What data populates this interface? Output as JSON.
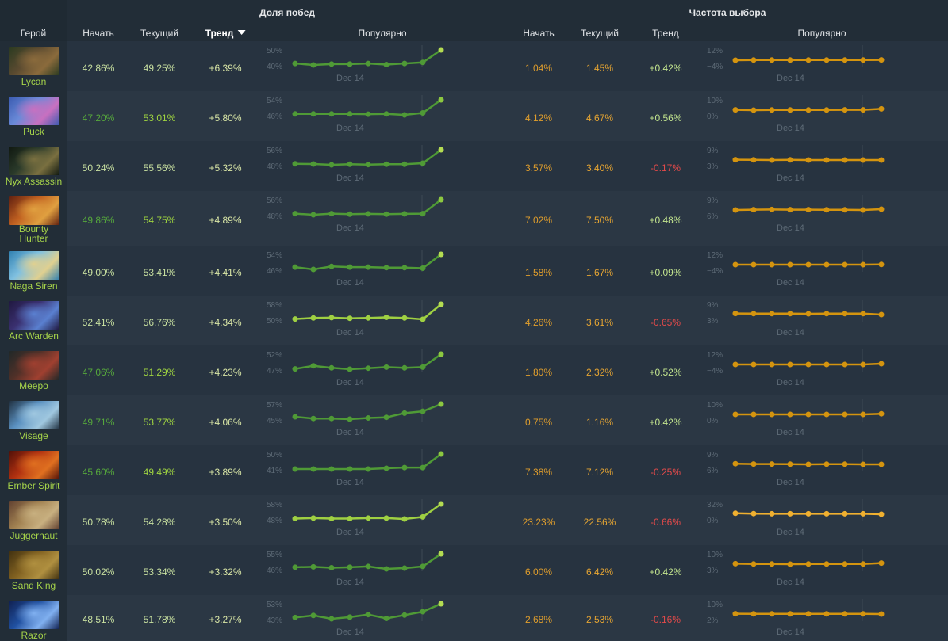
{
  "header": {
    "winrate_group": "Доля побед",
    "pickrate_group": "Частота выбора",
    "hero": "Герой",
    "start": "Начать",
    "current": "Текущий",
    "trend": "Тренд",
    "popular": "Популярно"
  },
  "colors": {
    "background": "#242f39",
    "hero_name": "#a6d44a",
    "win_line": "#4f9a36",
    "win_point_last": "#b4dc52",
    "pick_line": "#d4940f",
    "negative": "#e24a4a"
  },
  "date_label": "Dec 14",
  "rows": [
    {
      "hero": "Lycan",
      "name_lines": [
        "Lycan"
      ],
      "icon": "lycan-portrait-icon",
      "win_start": "42.86%",
      "win_current": "49.25%",
      "win_trend": "+6.39%",
      "win_axis": [
        "50%",
        "40%"
      ],
      "win_series": [
        42.9,
        42.2,
        42.6,
        42.6,
        42.9,
        42.4,
        42.9,
        43.4,
        49.3
      ],
      "pick_start": "1.04%",
      "pick_current": "1.45%",
      "pick_trend": "+0.42%",
      "pick_trend_neg": false,
      "pick_axis": [
        "12%",
        "−4%"
      ],
      "pick_series": [
        1.0,
        1.1,
        1.1,
        1.1,
        1.1,
        1.1,
        1.1,
        1.1,
        1.2
      ]
    },
    {
      "hero": "Puck",
      "name_lines": [
        "Puck"
      ],
      "icon": "puck-portrait-icon",
      "win_start": "47.20%",
      "win_current": "53.01%",
      "win_trend": "+5.80%",
      "win_axis": [
        "54%",
        "46%"
      ],
      "win_series": [
        47.2,
        47.2,
        47.2,
        47.2,
        47.1,
        47.2,
        46.8,
        47.6,
        53.0
      ],
      "pick_start": "4.12%",
      "pick_current": "4.67%",
      "pick_trend": "+0.56%",
      "pick_trend_neg": false,
      "pick_axis": [
        "10%",
        "0%"
      ],
      "pick_series": [
        4.1,
        3.9,
        4.0,
        4.0,
        4.0,
        4.0,
        4.1,
        4.1,
        4.7
      ]
    },
    {
      "hero": "Nyx Assassin",
      "name_lines": [
        "Nyx Assassin"
      ],
      "icon": "nyx-assassin-portrait-icon",
      "win_start": "50.24%",
      "win_current": "55.56%",
      "win_trend": "+5.32%",
      "win_axis": [
        "56%",
        "48%"
      ],
      "win_series": [
        50.2,
        50.1,
        49.8,
        50.0,
        49.9,
        50.0,
        50.0,
        50.4,
        55.6
      ],
      "pick_start": "3.57%",
      "pick_current": "3.40%",
      "pick_trend": "-0.17%",
      "pick_trend_neg": true,
      "pick_axis": [
        "9%",
        "3%"
      ],
      "pick_series": [
        3.6,
        3.5,
        3.4,
        3.5,
        3.4,
        3.4,
        3.4,
        3.4,
        3.4
      ]
    },
    {
      "hero": "Bounty Hunter",
      "name_lines": [
        "Bounty",
        "Hunter"
      ],
      "icon": "bounty-hunter-portrait-icon",
      "win_start": "49.86%",
      "win_current": "54.75%",
      "win_trend": "+4.89%",
      "win_axis": [
        "56%",
        "48%"
      ],
      "win_series": [
        49.9,
        49.5,
        49.9,
        49.7,
        49.8,
        49.7,
        49.8,
        49.9,
        54.8
      ],
      "pick_start": "7.02%",
      "pick_current": "7.50%",
      "pick_trend": "+0.48%",
      "pick_trend_neg": false,
      "pick_axis": [
        "9%",
        "6%"
      ],
      "pick_series": [
        7.0,
        7.2,
        7.3,
        7.2,
        7.2,
        7.1,
        7.1,
        7.0,
        7.5
      ]
    },
    {
      "hero": "Naga Siren",
      "name_lines": [
        "Naga Siren"
      ],
      "icon": "naga-siren-portrait-icon",
      "win_start": "49.00%",
      "win_current": "53.41%",
      "win_trend": "+4.41%",
      "win_axis": [
        "54%",
        "46%"
      ],
      "win_series": [
        49.0,
        48.2,
        49.2,
        49.0,
        49.0,
        48.8,
        48.8,
        48.6,
        53.4
      ],
      "pick_start": "1.58%",
      "pick_current": "1.67%",
      "pick_trend": "+0.09%",
      "pick_trend_neg": false,
      "pick_axis": [
        "12%",
        "−4%"
      ],
      "pick_series": [
        1.6,
        1.6,
        1.6,
        1.6,
        1.6,
        1.6,
        1.6,
        1.6,
        1.7
      ]
    },
    {
      "hero": "Arc Warden",
      "name_lines": [
        "Arc Warden"
      ],
      "icon": "arc-warden-portrait-icon",
      "win_start": "52.41%",
      "win_current": "56.76%",
      "win_trend": "+4.34%",
      "win_axis": [
        "58%",
        "50%"
      ],
      "win_series": [
        52.4,
        52.7,
        52.8,
        52.6,
        52.7,
        52.9,
        52.7,
        52.3,
        56.8
      ],
      "pick_start": "4.26%",
      "pick_current": "3.61%",
      "pick_trend": "-0.65%",
      "pick_trend_neg": true,
      "pick_axis": [
        "9%",
        "3%"
      ],
      "pick_series": [
        4.3,
        4.2,
        4.2,
        4.2,
        4.1,
        4.2,
        4.2,
        4.2,
        3.6
      ]
    },
    {
      "hero": "Meepo",
      "name_lines": [
        "Meepo"
      ],
      "icon": "meepo-portrait-icon",
      "win_start": "47.06%",
      "win_current": "51.29%",
      "win_trend": "+4.23%",
      "win_axis": [
        "52%",
        "47%"
      ],
      "win_series": [
        47.0,
        47.9,
        47.3,
        46.9,
        47.2,
        47.5,
        47.3,
        47.5,
        51.3
      ],
      "pick_start": "1.80%",
      "pick_current": "2.32%",
      "pick_trend": "+0.52%",
      "pick_trend_neg": false,
      "pick_axis": [
        "12%",
        "−4%"
      ],
      "pick_series": [
        1.8,
        1.8,
        1.8,
        1.8,
        1.8,
        1.8,
        1.8,
        1.8,
        2.3
      ]
    },
    {
      "hero": "Visage",
      "name_lines": [
        "Visage"
      ],
      "icon": "visage-portrait-icon",
      "win_start": "49.71%",
      "win_current": "53.77%",
      "win_trend": "+4.06%",
      "win_axis": [
        "57%",
        "45%"
      ],
      "win_series": [
        49.7,
        49.4,
        49.4,
        49.3,
        49.5,
        49.6,
        50.3,
        50.6,
        51.8
      ],
      "pick_start": "0.75%",
      "pick_current": "1.16%",
      "pick_trend": "+0.42%",
      "pick_trend_neg": false,
      "pick_axis": [
        "10%",
        "0%"
      ],
      "pick_series": [
        0.8,
        0.8,
        0.8,
        0.8,
        0.8,
        0.8,
        0.8,
        0.8,
        1.2
      ]
    },
    {
      "hero": "Ember Spirit",
      "name_lines": [
        "Ember Spirit"
      ],
      "icon": "ember-spirit-portrait-icon",
      "win_start": "45.60%",
      "win_current": "49.49%",
      "win_trend": "+3.89%",
      "win_axis": [
        "50%",
        "41%"
      ],
      "win_series": [
        45.6,
        45.6,
        45.6,
        45.6,
        45.6,
        45.8,
        46.0,
        46.0,
        49.5
      ],
      "pick_start": "7.38%",
      "pick_current": "7.12%",
      "pick_trend": "-0.25%",
      "pick_trend_neg": true,
      "pick_axis": [
        "9%",
        "6%"
      ],
      "pick_series": [
        7.4,
        7.2,
        7.2,
        7.1,
        7.0,
        7.1,
        7.1,
        7.0,
        7.0
      ]
    },
    {
      "hero": "Juggernaut",
      "name_lines": [
        "Juggernaut"
      ],
      "icon": "juggernaut-portrait-icon",
      "win_start": "50.78%",
      "win_current": "54.28%",
      "win_trend": "+3.50%",
      "win_axis": [
        "58%",
        "48%"
      ],
      "win_series": [
        50.8,
        50.9,
        50.8,
        50.8,
        50.9,
        50.9,
        50.7,
        51.2,
        54.3
      ],
      "pick_start": "23.23%",
      "pick_current": "22.56%",
      "pick_trend": "-0.66%",
      "pick_trend_neg": true,
      "pick_axis": [
        "32%",
        "0%"
      ],
      "pick_series": [
        23.2,
        23.0,
        22.9,
        22.9,
        22.9,
        22.9,
        22.9,
        22.9,
        22.6
      ]
    },
    {
      "hero": "Sand King",
      "name_lines": [
        "Sand King"
      ],
      "icon": "sand-king-portrait-icon",
      "win_start": "50.02%",
      "win_current": "53.34%",
      "win_trend": "+3.32%",
      "win_axis": [
        "55%",
        "46%"
      ],
      "win_series": [
        50.0,
        50.1,
        49.9,
        50.0,
        50.2,
        49.6,
        49.8,
        50.2,
        53.3
      ],
      "pick_start": "6.00%",
      "pick_current": "6.42%",
      "pick_trend": "+0.42%",
      "pick_trend_neg": false,
      "pick_axis": [
        "10%",
        "3%"
      ],
      "pick_series": [
        6.0,
        5.8,
        5.8,
        5.7,
        5.8,
        5.8,
        5.8,
        5.8,
        6.4
      ]
    },
    {
      "hero": "Razor",
      "name_lines": [
        "Razor"
      ],
      "icon": "razor-portrait-icon",
      "win_start": "48.51%",
      "win_current": "51.78%",
      "win_trend": "+3.27%",
      "win_axis": [
        "53%",
        "43%"
      ],
      "win_series": [
        48.5,
        49.0,
        48.2,
        48.6,
        49.2,
        48.3,
        49.1,
        49.9,
        51.8
      ],
      "pick_start": "2.68%",
      "pick_current": "2.53%",
      "pick_trend": "-0.16%",
      "pick_trend_neg": true,
      "pick_axis": [
        "10%",
        "2%"
      ],
      "pick_series": [
        2.7,
        2.6,
        2.6,
        2.6,
        2.6,
        2.6,
        2.6,
        2.6,
        2.5
      ]
    }
  ]
}
